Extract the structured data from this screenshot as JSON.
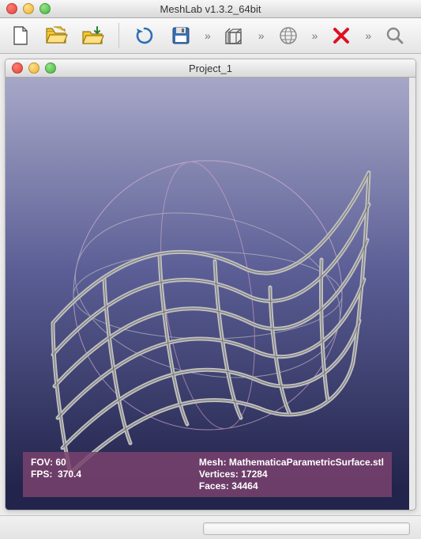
{
  "window": {
    "title": "MeshLab v1.3.2_64bit"
  },
  "toolbar": {
    "items": [
      {
        "name": "new-project-icon"
      },
      {
        "name": "open-project-icon"
      },
      {
        "name": "import-mesh-icon"
      },
      {
        "name": "reload-icon"
      },
      {
        "name": "save-icon"
      },
      {
        "name": "toolbar-expand-1",
        "chev": true
      },
      {
        "name": "render-cube-icon"
      },
      {
        "name": "toolbar-expand-2",
        "chev": true
      },
      {
        "name": "globe-icon"
      },
      {
        "name": "toolbar-expand-3",
        "chev": true
      },
      {
        "name": "delete-mesh-icon"
      },
      {
        "name": "toolbar-expand-4",
        "chev": true
      },
      {
        "name": "search-icon"
      }
    ]
  },
  "project": {
    "title": "Project_1"
  },
  "status": {
    "fov_label": "FOV:",
    "fov_value": "60",
    "fps_label": "FPS:",
    "fps_value": "370.4",
    "mesh_label": "Mesh:",
    "mesh_value": "MathematicaParametricSurface.stl",
    "vertices_label": "Vertices:",
    "vertices_value": "17284",
    "faces_label": "Faces:",
    "faces_value": "34464"
  }
}
